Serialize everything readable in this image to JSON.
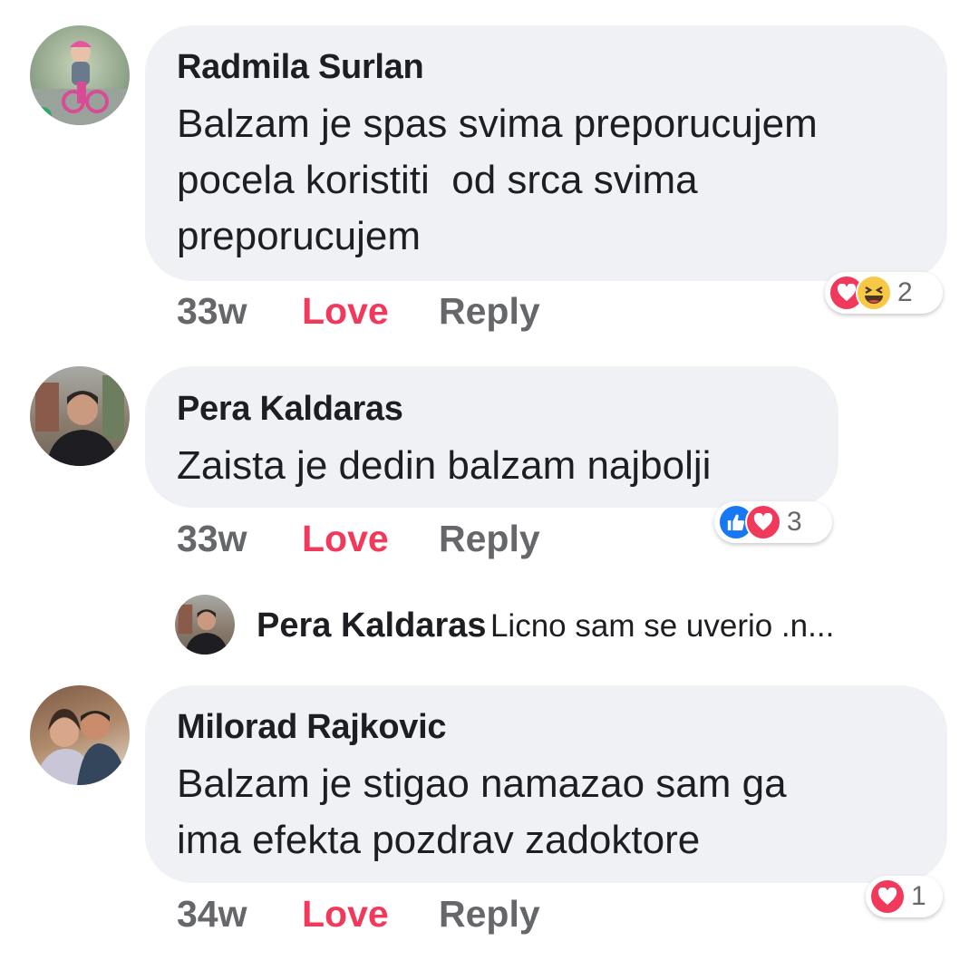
{
  "accent": {
    "love": "#f0395b",
    "like": "#1877f2",
    "haha": "#f7c746",
    "bubble": "#f0f1f5",
    "meta": "#65676b"
  },
  "comments": [
    {
      "author": "Radmila Surlan",
      "lines": [
        "Balzam je spas svima preporucujem",
        "pocela koristiti  od srca svima",
        "preporucujem"
      ],
      "time": "33w",
      "love_label": "Love",
      "reply_label": "Reply",
      "reactions": [
        "heart-icon",
        "haha-icon"
      ],
      "reaction_count": "2"
    },
    {
      "author": "Pera Kaldaras",
      "lines": [
        "Zaista je dedin balzam najbolji"
      ],
      "time": "33w",
      "love_label": "Love",
      "reply_label": "Reply",
      "reactions": [
        "like-icon",
        "heart-icon"
      ],
      "reaction_count": "3",
      "reply_preview": {
        "author": "Pera Kaldaras",
        "text": "Licno sam se uverio .n..."
      }
    },
    {
      "author": "Milorad Rajkovic",
      "lines": [
        "Balzam je stigao namazao sam ga",
        "ima efekta pozdrav zadoktore"
      ],
      "time": "34w",
      "love_label": "Love",
      "reply_label": "Reply",
      "reactions": [
        "heart-icon"
      ],
      "reaction_count": "1"
    }
  ]
}
